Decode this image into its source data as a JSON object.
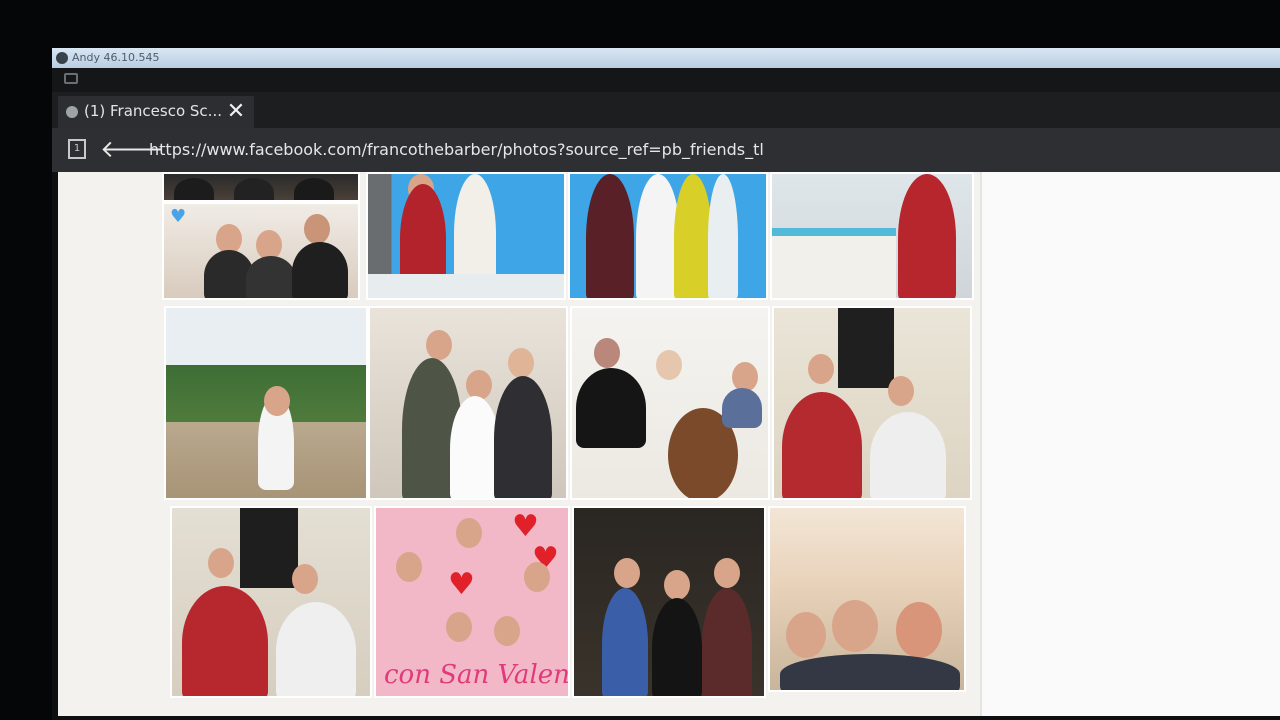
{
  "window": {
    "title": "Andy 46.10.545"
  },
  "browser": {
    "tab_title": "(1) Francesco Sc...",
    "close_glyph": "✕",
    "tabs_counter": "1",
    "back_glyph": "🡐",
    "url": "https://www.facebook.com/francothebarber/photos?source_ref=pb_friends_tl"
  },
  "photos": {
    "caption": "con San Valentino",
    "heart_glyph": "♥"
  },
  "colors": {
    "pool_blue": "#3ea6e6",
    "page_background": "#f3f2ee",
    "heart_blue": "#4aa3e8",
    "valentine_pink": "#f3b8c8"
  }
}
